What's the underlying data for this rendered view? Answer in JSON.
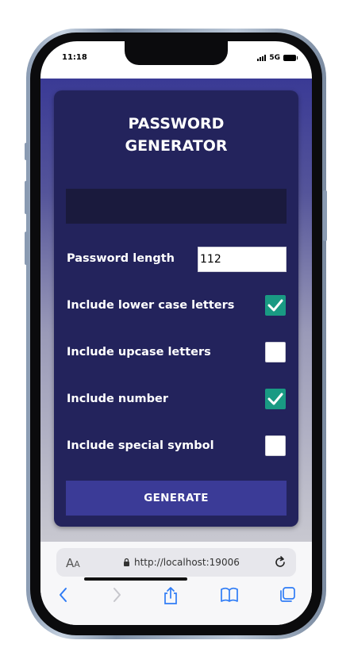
{
  "status_bar": {
    "time": "11:18",
    "network": "5G"
  },
  "app": {
    "title": "PASSWORD\nGENERATOR",
    "password_output": "",
    "length_label": "Password length",
    "length_value": "112",
    "options": [
      {
        "label": "Include lower case letters",
        "checked": true
      },
      {
        "label": "Include upcase letters",
        "checked": false
      },
      {
        "label": "Include number",
        "checked": true
      },
      {
        "label": "Include special symbol",
        "checked": false
      }
    ],
    "generate_label": "GENERATE",
    "colors": {
      "background_top": "#3a3a95",
      "card": "#23235c",
      "output": "#1a1a3d",
      "checkbox_checked": "#199a83",
      "button": "#3b3b97"
    }
  },
  "browser": {
    "text_size_label": "AA",
    "url": "http://localhost:19006",
    "icons": [
      "lock-icon",
      "reload-icon",
      "back-icon",
      "forward-icon",
      "share-icon",
      "bookmarks-icon",
      "tabs-icon"
    ]
  }
}
